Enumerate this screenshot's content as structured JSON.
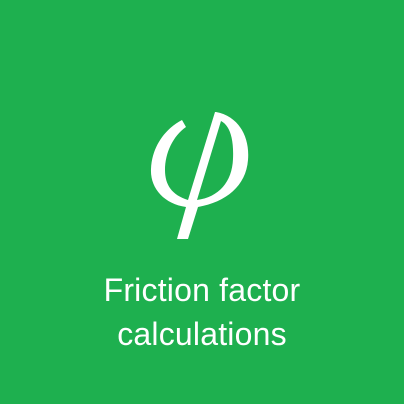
{
  "tile": {
    "icon": "phi-icon",
    "label_line1": "Friction factor",
    "label_line2": "calculations",
    "background_color": "#1eb04f",
    "foreground_color": "#ffffff"
  }
}
